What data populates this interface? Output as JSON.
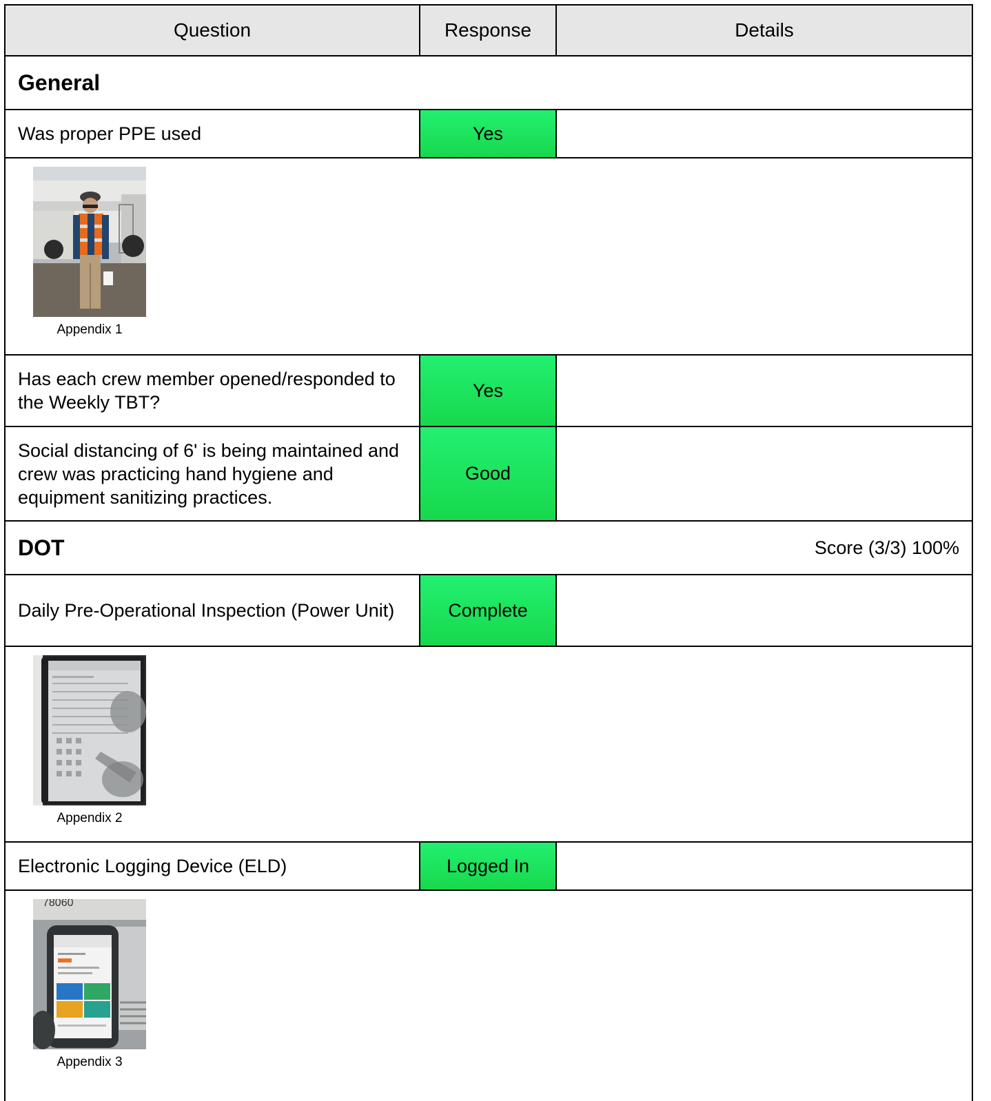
{
  "header": {
    "question": "Question",
    "response": "Response",
    "details": "Details"
  },
  "sections": [
    {
      "title": "General",
      "score": ""
    },
    {
      "title": "DOT",
      "score": "Score (3/3) 100%"
    }
  ],
  "rows": [
    {
      "question": "Was proper PPE used",
      "response": "Yes",
      "details": ""
    },
    {
      "question": "Has each crew member opened/responded to the Weekly TBT?",
      "response": "Yes",
      "details": ""
    },
    {
      "question": "Social distancing of 6' is being maintained and crew was practicing hand hygiene and equipment sanitizing practices.",
      "response": "Good",
      "details": ""
    },
    {
      "question": "Daily Pre-Operational Inspection (Power Unit)",
      "response": "Complete",
      "details": ""
    },
    {
      "question": "Electronic Logging Device (ELD)",
      "response": "Logged In",
      "details": ""
    }
  ],
  "appendices": [
    {
      "caption": "Appendix 1",
      "photo": "worker-in-safety-vest-photo"
    },
    {
      "caption": "Appendix 2",
      "photo": "tablet-inspection-form-photo"
    },
    {
      "caption": "Appendix 3",
      "photo": "phone-eld-app-photo",
      "photo_text": "78060"
    }
  ],
  "colors": {
    "response_green": "#1ee35e",
    "header_gray": "#e6e6e6"
  }
}
